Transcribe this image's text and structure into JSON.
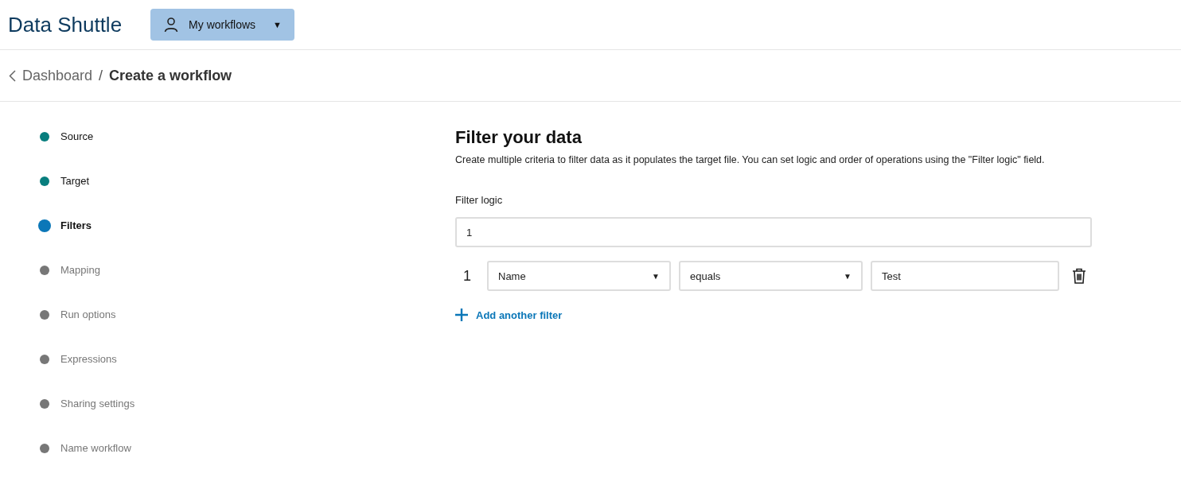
{
  "app": {
    "title": "Data Shuttle",
    "menu_button": {
      "label": "My workflows",
      "caret": "▼"
    }
  },
  "breadcrumb": {
    "back": "Dashboard",
    "separator": "/",
    "current": "Create a workflow"
  },
  "steps": [
    {
      "label": "Source",
      "kind": "complete",
      "selected": false
    },
    {
      "label": "Target",
      "kind": "complete",
      "selected": false
    },
    {
      "label": "Filters",
      "kind": "current",
      "selected": true
    },
    {
      "label": "Mapping",
      "kind": "upcoming",
      "selected": false
    },
    {
      "label": "Run options",
      "kind": "upcoming",
      "selected": false
    },
    {
      "label": "Expressions",
      "kind": "upcoming",
      "selected": false
    },
    {
      "label": "Sharing settings",
      "kind": "upcoming",
      "selected": false
    },
    {
      "label": "Name workflow",
      "kind": "upcoming",
      "selected": false
    }
  ],
  "section": {
    "heading": "Filter your data",
    "description": "Create multiple criteria to filter data as it populates the target file. You can set logic and order of operations using the \"Filter logic\" field.",
    "filter_logic": {
      "label": "Filter logic",
      "value": "1"
    },
    "filters": [
      {
        "number": "1",
        "field": "Name",
        "operator": "equals",
        "value": "Test",
        "caret": "▼"
      }
    ],
    "add_button": "Add another filter"
  }
}
